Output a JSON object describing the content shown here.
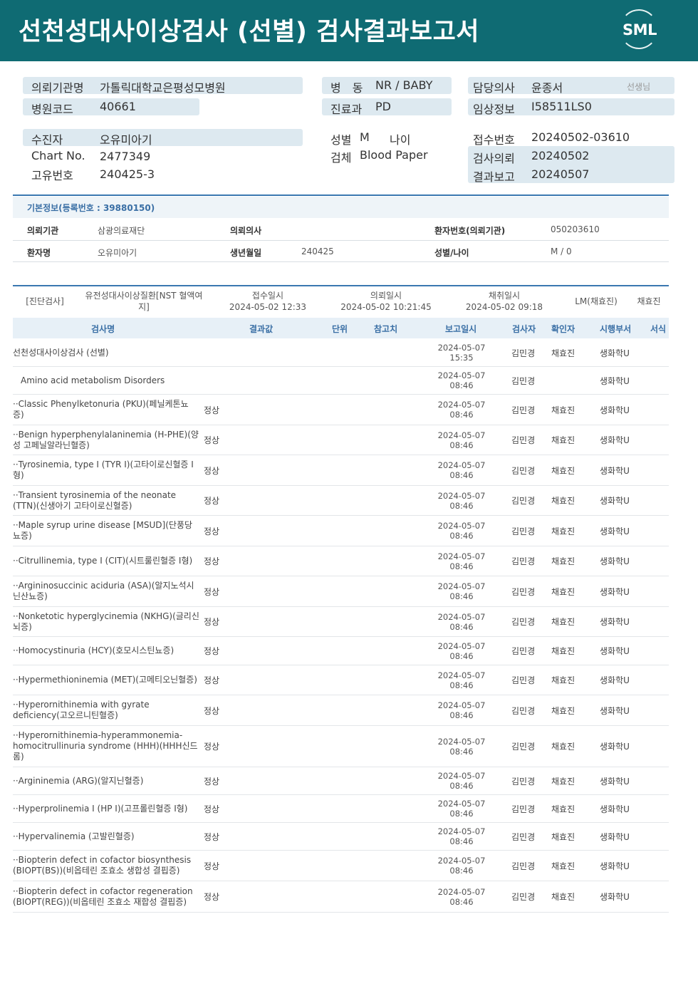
{
  "title": "선천성대사이상검사 (선별) 검사결과보고서",
  "logo_text": "SML",
  "header": {
    "institution_label": "의뢰기관명",
    "institution_value": "가톨릭대학교은평성모병원",
    "hospital_code_label": "병원코드",
    "hospital_code_value": "40661",
    "ward_label": "병　동",
    "ward_value": "NR / BABY",
    "department_label": "진료과",
    "department_value": "PD",
    "doctor_label": "담당의사",
    "doctor_value": "윤종서",
    "doctor_suffix": "선생님",
    "clinical_label": "임상정보",
    "clinical_value": "I58511LS0",
    "patient_label": "수진자",
    "patient_value": "오유미아기",
    "chart_label": "Chart No.",
    "chart_value": "2477349",
    "unique_label": "고유번호",
    "unique_value": "240425-3",
    "sex_label": "성별",
    "sex_value": "M",
    "age_label": "나이",
    "specimen_label": "검체",
    "specimen_value": "Blood Paper",
    "receipt_label": "접수번호",
    "receipt_value": "20240502-03610",
    "request_label": "검사의뢰",
    "request_value": "20240502",
    "report_label": "결과보고",
    "report_value": "20240507"
  },
  "basic": {
    "title": "기본정보(등록번호 : 39880150)",
    "org_label": "의뢰기관",
    "org_value": "삼광의료재단",
    "req_doctor_label": "의뢰의사",
    "req_doctor_value": "",
    "patno_label": "환자번호(의뢰기관)",
    "patno_value": "050203610",
    "name_label": "환자명",
    "name_value": "오유미아기",
    "dob_label": "생년월일",
    "dob_value": "240425",
    "sexage_label": "성별/나이",
    "sexage_value": "M / 0"
  },
  "meta": {
    "category": "[진단검사]",
    "test_name": "유전성대사이상질환[NST 혈액여지]",
    "received_label": "접수일시",
    "received_value": "2024-05-02 12:33",
    "requested_label": "의뢰일시",
    "requested_value": "2024-05-02 10:21:45",
    "collected_label": "채취일시",
    "collected_value": "2024-05-02 09:18",
    "collector": "LM(채효진)",
    "collector2": "채효진"
  },
  "columns": {
    "name": "검사명",
    "result": "결과값",
    "unit": "단위",
    "ref": "참고치",
    "report_date": "보고일시",
    "tester": "검사자",
    "confirmer": "확인자",
    "dept": "시행부서",
    "form": "서식"
  },
  "rows": [
    {
      "name": "선천성대사이상검사 (선별)",
      "result": "",
      "date": "2024-05-07",
      "time": "15:35",
      "tester": "김민경",
      "confirmer": "채효진",
      "dept": "생화학U"
    },
    {
      "name": "Amino acid metabolism Disorders",
      "result": "",
      "date": "2024-05-07",
      "time": "08:46",
      "tester": "김민경",
      "confirmer": "",
      "dept": "생화학U"
    },
    {
      "name": "··Classic Phenylketonuria (PKU)(페닐케톤뇨증)",
      "result": "정상",
      "date": "2024-05-07",
      "time": "08:46",
      "tester": "김민경",
      "confirmer": "채효진",
      "dept": "생화학U"
    },
    {
      "name": "··Benign hyperphenylalaninemia (H-PHE)(양성 고페닐알라닌혈증)",
      "result": "정상",
      "date": "2024-05-07",
      "time": "08:46",
      "tester": "김민경",
      "confirmer": "채효진",
      "dept": "생화학U"
    },
    {
      "name": "··Tyrosinemia, type I (TYR I)(고타이로신혈증 I형)",
      "result": "정상",
      "date": "2024-05-07",
      "time": "08:46",
      "tester": "김민경",
      "confirmer": "채효진",
      "dept": "생화학U"
    },
    {
      "name": "··Transient tyrosinemia of the neonate (TTN)(신생아기 고타이로신혈증)",
      "result": "정상",
      "date": "2024-05-07",
      "time": "08:46",
      "tester": "김민경",
      "confirmer": "채효진",
      "dept": "생화학U"
    },
    {
      "name": "··Maple syrup urine disease [MSUD](단풍당뇨증)",
      "result": "정상",
      "date": "2024-05-07",
      "time": "08:46",
      "tester": "김민경",
      "confirmer": "채효진",
      "dept": "생화학U"
    },
    {
      "name": "··Citrullinemia, type I (CIT)(시트룰린혈증 I형)",
      "result": "정상",
      "date": "2024-05-07",
      "time": "08:46",
      "tester": "김민경",
      "confirmer": "채효진",
      "dept": "생화학U"
    },
    {
      "name": "··Argininosuccinic aciduria (ASA)(알지노석시닌산뇨증)",
      "result": "정상",
      "date": "2024-05-07",
      "time": "08:46",
      "tester": "김민경",
      "confirmer": "채효진",
      "dept": "생화학U"
    },
    {
      "name": "··Nonketotic hyperglycinemia (NKHG)(글리신뇌증)",
      "result": "정상",
      "date": "2024-05-07",
      "time": "08:46",
      "tester": "김민경",
      "confirmer": "채효진",
      "dept": "생화학U"
    },
    {
      "name": "··Homocystinuria (HCY)(호모시스틴뇨증)",
      "result": "정상",
      "date": "2024-05-07",
      "time": "08:46",
      "tester": "김민경",
      "confirmer": "채효진",
      "dept": "생화학U"
    },
    {
      "name": "··Hypermethioninemia (MET)(고메티오닌혈증)",
      "result": "정상",
      "date": "2024-05-07",
      "time": "08:46",
      "tester": "김민경",
      "confirmer": "채효진",
      "dept": "생화학U"
    },
    {
      "name": "··Hyperornithinemia with gyrate deficiency(고오르니틴혈증)",
      "result": "정상",
      "date": "2024-05-07",
      "time": "08:46",
      "tester": "김민경",
      "confirmer": "채효진",
      "dept": "생화학U"
    },
    {
      "name": "··Hyperornithinemia-hyperammonemia-homocitrullinuria syndrome (HHH)(HHH신드롬)",
      "result": "정상",
      "date": "2024-05-07",
      "time": "08:46",
      "tester": "김민경",
      "confirmer": "채효진",
      "dept": "생화학U"
    },
    {
      "name": "··Argininemia (ARG)(알지닌혈증)",
      "result": "정상",
      "date": "2024-05-07",
      "time": "08:46",
      "tester": "김민경",
      "confirmer": "채효진",
      "dept": "생화학U"
    },
    {
      "name": "··Hyperprolinemia I (HP I)(고프롤린혈증 I형)",
      "result": "정상",
      "date": "2024-05-07",
      "time": "08:46",
      "tester": "김민경",
      "confirmer": "채효진",
      "dept": "생화학U"
    },
    {
      "name": "··Hypervalinemia (고발린혈증)",
      "result": "정상",
      "date": "2024-05-07",
      "time": "08:46",
      "tester": "김민경",
      "confirmer": "채효진",
      "dept": "생화학U"
    },
    {
      "name": "··Biopterin defect in cofactor biosynthesis (BIOPT(BS))(비옵테린 조효소 생합성 결핍증)",
      "result": "정상",
      "date": "2024-05-07",
      "time": "08:46",
      "tester": "김민경",
      "confirmer": "채효진",
      "dept": "생화학U"
    },
    {
      "name": "··Biopterin defect in cofactor regeneration (BIOPT(REG))(비옵테린 조효소 재합성 결핍증)",
      "result": "정상",
      "date": "2024-05-07",
      "time": "08:46",
      "tester": "김민경",
      "confirmer": "채효진",
      "dept": "생화학U"
    }
  ]
}
